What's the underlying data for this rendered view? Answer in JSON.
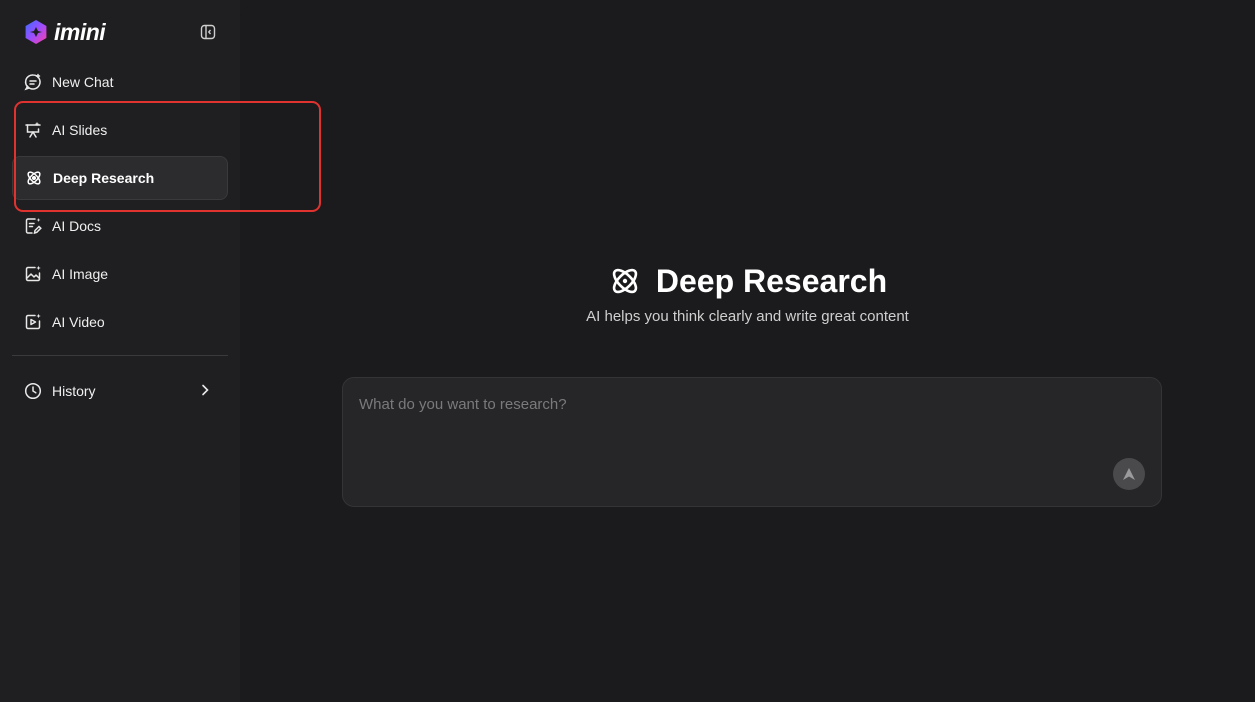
{
  "brand": {
    "name": "imini"
  },
  "sidebar": {
    "items": [
      {
        "label": "New Chat",
        "icon": "new-chat-icon"
      },
      {
        "label": "AI Slides",
        "icon": "slides-icon"
      },
      {
        "label": "Deep Research",
        "icon": "atom-icon",
        "active": true
      },
      {
        "label": "AI Docs",
        "icon": "docs-icon"
      },
      {
        "label": "AI Image",
        "icon": "image-icon"
      },
      {
        "label": "AI Video",
        "icon": "video-icon"
      }
    ],
    "history": {
      "label": "History",
      "icon": "clock-icon"
    }
  },
  "main": {
    "title": "Deep Research",
    "subtitle": "AI helps you think clearly and write great content",
    "input": {
      "placeholder": "What do you want to research?",
      "value": ""
    }
  },
  "colors": {
    "background": "#1b1b1d",
    "sidebar": "#1f1f21",
    "highlight": "#e0322f",
    "brand_gradient_start": "#7c4dff",
    "brand_gradient_end": "#ff3fa4"
  }
}
